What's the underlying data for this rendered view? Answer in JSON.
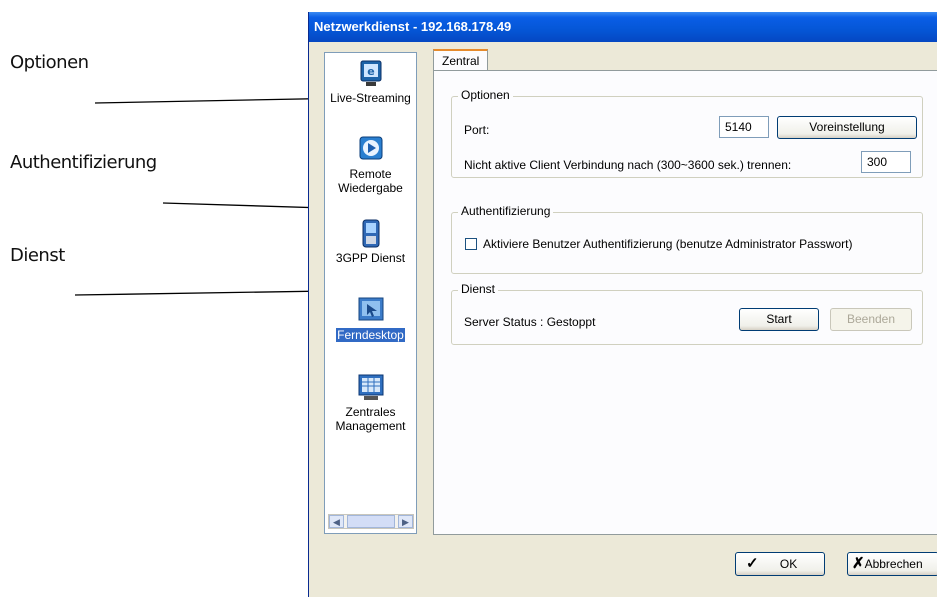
{
  "annotations": {
    "optionen": "Optionen",
    "authentifizierung": "Authentifizierung",
    "dienst": "Dienst"
  },
  "window": {
    "title": "Netzwerkdienst - 192.168.178.49",
    "close_glyph": "✕"
  },
  "sidebar": {
    "items": [
      {
        "label": "Live-Streaming",
        "icon": "live-streaming-icon"
      },
      {
        "label": "Remote Wiedergabe",
        "icon": "remote-playback-icon"
      },
      {
        "label": "3GPP Dienst",
        "icon": "3gpp-phone-icon"
      },
      {
        "label": "Ferndesktop",
        "icon": "remote-desktop-icon",
        "selected": true
      },
      {
        "label": "Zentrales Management",
        "icon": "central-management-icon"
      }
    ]
  },
  "tab": {
    "label": "Zentral"
  },
  "options": {
    "title": "Optionen",
    "port_label": "Port:",
    "port_value": "5140",
    "default_button": "Voreinstellung",
    "timeout_label": "Nicht aktive Client Verbindung nach (300~3600 sek.) trennen:",
    "timeout_value": "300"
  },
  "auth": {
    "title": "Authentifizierung",
    "checkbox_label": "Aktiviere Benutzer Authentifizierung (benutze Administrator Passwort)",
    "checked": false
  },
  "service": {
    "title": "Dienst",
    "status_text": "Server Status : Gestoppt",
    "start_button": "Start",
    "stop_button": "Beenden"
  },
  "footer": {
    "ok_label": "OK",
    "cancel_label": "Abbrechen"
  },
  "colors": {
    "titlebar": "#0556d6",
    "selection": "#316ac5",
    "tab_highlight": "#e68b2c"
  }
}
